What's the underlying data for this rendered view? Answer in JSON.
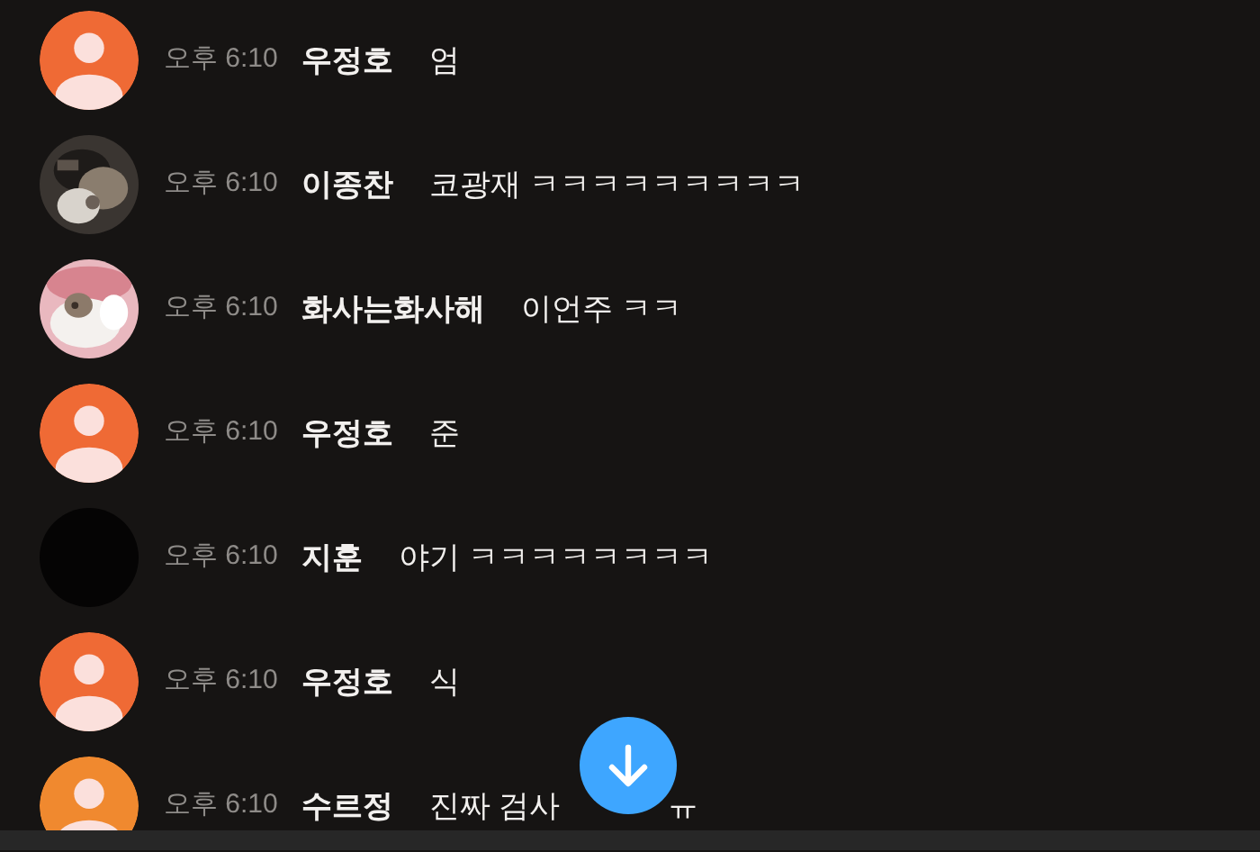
{
  "messages": [
    {
      "avatar": {
        "kind": "default",
        "color": "#ef6a35"
      },
      "time": "오후 6:10",
      "author": "우정호",
      "text": "엄"
    },
    {
      "time": "오후 6:10",
      "author": "이종찬",
      "text": "코광재 ㅋㅋㅋㅋㅋㅋㅋㅋㅋ"
    },
    {
      "time": "오후 6:10",
      "author": "화사는화사해",
      "text": "이언주 ㅋㅋ"
    },
    {
      "avatar": {
        "kind": "default",
        "color": "#ef6a35"
      },
      "time": "오후 6:10",
      "author": "우정호",
      "text": "준"
    },
    {
      "avatar": {
        "kind": "blank"
      },
      "time": "오후 6:10",
      "author": "지훈",
      "text": "야기 ㅋㅋㅋㅋㅋㅋㅋㅋ"
    },
    {
      "avatar": {
        "kind": "default",
        "color": "#ef6a35"
      },
      "time": "오후 6:10",
      "author": "우정호",
      "text": "식"
    },
    {
      "avatar": {
        "kind": "default",
        "color": "#f0892f"
      },
      "time": "오후 6:10",
      "author": "수르정",
      "text": "진짜 검사",
      "text_tail": "ㅠ"
    }
  ]
}
